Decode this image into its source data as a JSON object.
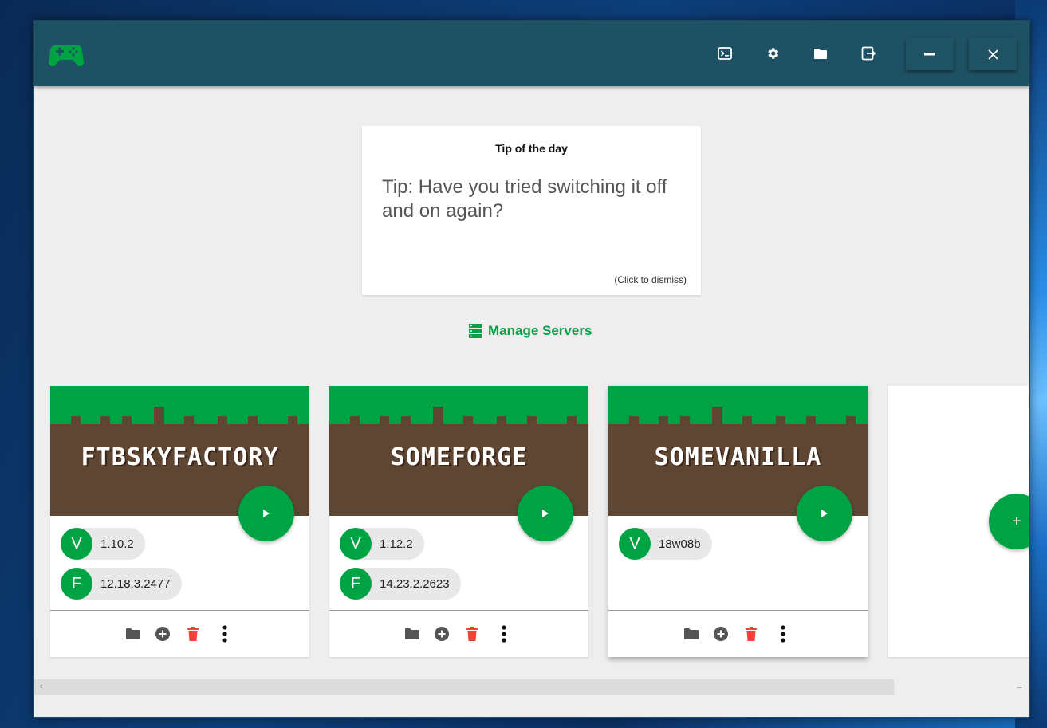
{
  "titlebar": {
    "logo_icon": "gamepad-icon",
    "actions": [
      {
        "name": "console-icon"
      },
      {
        "name": "settings-icon"
      },
      {
        "name": "folder-icon"
      },
      {
        "name": "logout-icon"
      }
    ],
    "minimize_icon": "minimize-icon",
    "close_icon": "close-icon"
  },
  "tip": {
    "title": "Tip of the day",
    "text": "Tip: Have you tried switching it off and on again?",
    "dismiss": "(Click to dismiss)"
  },
  "manage_servers": {
    "label": "Manage Servers",
    "icon": "server-list-icon"
  },
  "servers": [
    {
      "name": "FTBSKYFACTORY",
      "versions": [
        {
          "letter": "V",
          "value": "1.10.2"
        },
        {
          "letter": "F",
          "value": "12.18.3.2477"
        }
      ]
    },
    {
      "name": "SOMEFORGE",
      "versions": [
        {
          "letter": "V",
          "value": "1.12.2"
        },
        {
          "letter": "F",
          "value": "14.23.2.2623"
        }
      ]
    },
    {
      "name": "SOMEVANILLA",
      "versions": [
        {
          "letter": "V",
          "value": "18w08b"
        }
      ]
    }
  ],
  "add_server": {
    "label": "+"
  },
  "colors": {
    "accent": "#00a344",
    "titlebar": "#1e5163",
    "grass": "#00a344",
    "dirt": "#5f4633",
    "delete": "#f44336"
  },
  "scrollbar": {
    "left_arrow": "‹",
    "right_arrow": "→"
  }
}
